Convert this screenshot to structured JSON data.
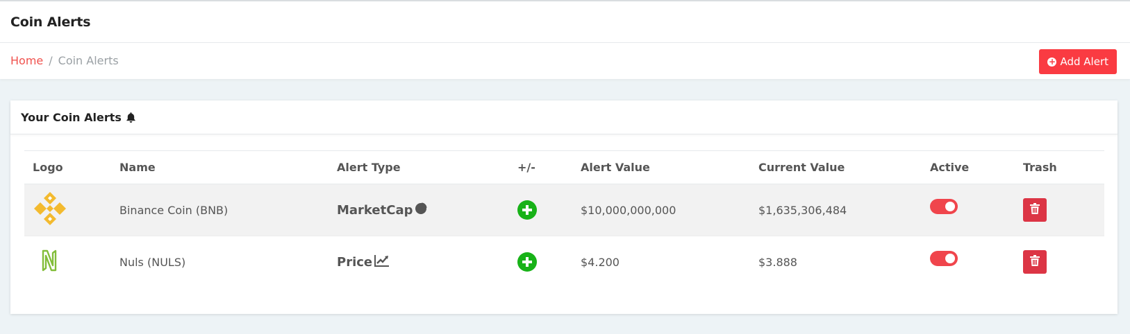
{
  "page": {
    "title": "Coin Alerts"
  },
  "breadcrumb": {
    "home": "Home",
    "separator": "/",
    "current": "Coin Alerts"
  },
  "actions": {
    "add_alert": "Add Alert"
  },
  "card": {
    "title": "Your Coin Alerts",
    "title_icon": "bell-icon"
  },
  "table": {
    "headers": [
      "Logo",
      "Name",
      "Alert Type",
      "+/-",
      "Alert Value",
      "Current Value",
      "Active",
      "Trash"
    ],
    "rows": [
      {
        "logo": "binance-logo",
        "name": "Binance Coin (BNB)",
        "alert_type": "MarketCap",
        "alert_type_icon": "pie-chart-icon",
        "direction_icon": "plus-circle-icon",
        "alert_value": "$10,000,000,000",
        "current_value": "$1,635,306,484",
        "active": true
      },
      {
        "logo": "nuls-logo",
        "name": "Nuls (NULS)",
        "alert_type": "Price",
        "alert_type_icon": "line-chart-icon",
        "direction_icon": "plus-circle-icon",
        "alert_value": "$4.200",
        "current_value": "$3.888",
        "active": true
      }
    ]
  },
  "colors": {
    "accent": "#fa3b42",
    "home_link": "#f0524e",
    "plus": "#18b218",
    "trash": "#dc3545",
    "toggle_on": "#f0454c",
    "binance": "#f3ba2f",
    "nuls": "#82bd39"
  }
}
